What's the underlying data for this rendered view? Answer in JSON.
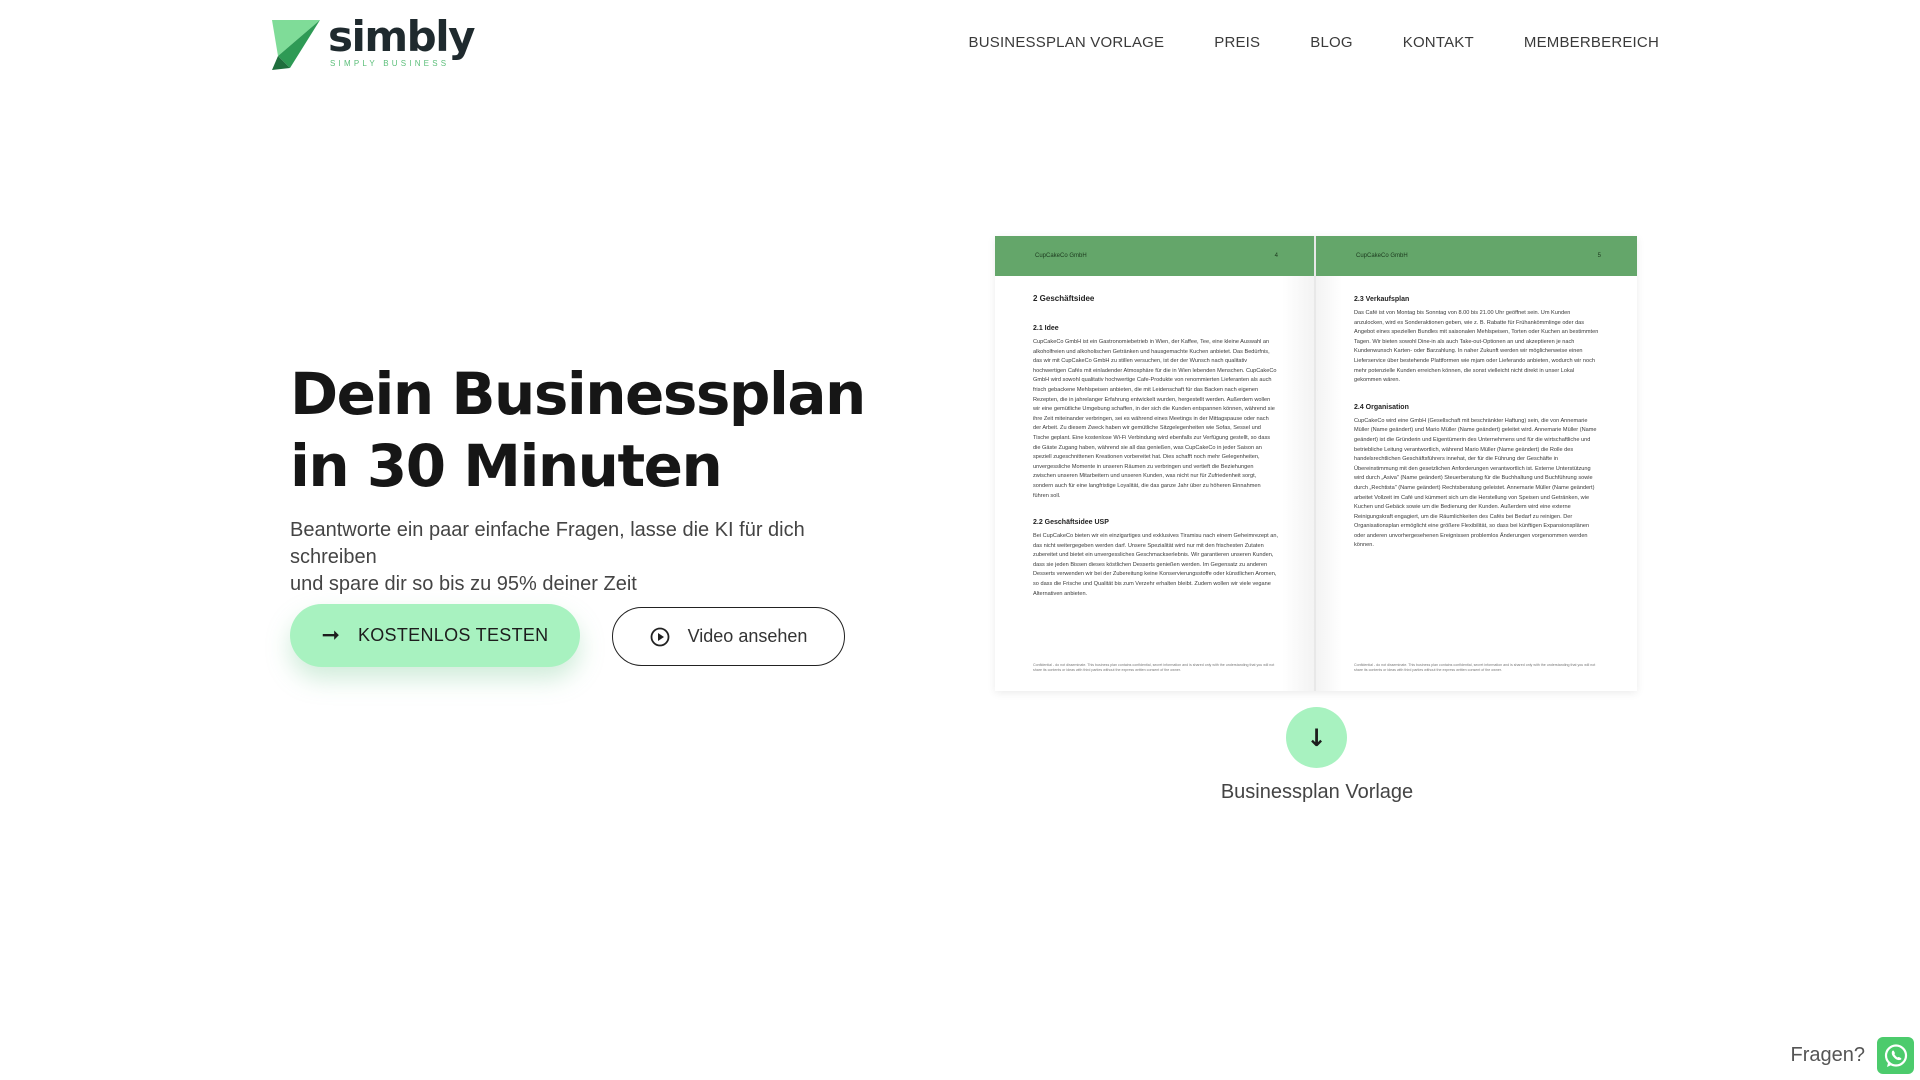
{
  "brand": {
    "name": "simbly",
    "tagline": "SIMPLY BUSINESS",
    "color_dark": "#1f2a2e",
    "color_green": "#5cbf7a"
  },
  "nav": {
    "items": [
      {
        "label": "BUSINESSPLAN VORLAGE"
      },
      {
        "label": "PREIS"
      },
      {
        "label": "BLOG"
      },
      {
        "label": "KONTAKT"
      },
      {
        "label": "MEMBERBEREICH"
      }
    ]
  },
  "hero": {
    "title_line1": "Dein Businessplan",
    "title_line2": "in 30 Minuten",
    "subtitle_line1": "Beantworte ein paar einfache Fragen, lasse die KI für dich schreiben",
    "subtitle_line2": "und spare dir so bis zu 95% deiner Zeit",
    "cta_primary": {
      "label": "KOSTENLOS TESTEN",
      "icon": "arrow-right-icon"
    },
    "cta_video": {
      "label": "Video ansehen",
      "icon": "play-circle-icon"
    },
    "accent_color": "#a8f2c0"
  },
  "document": {
    "header_color": "#64a66a",
    "left_page": {
      "company": "CupCakeCo GmbH",
      "page": "4",
      "h1": "2   Geschäftsidee",
      "sections": [
        {
          "heading": "2.1  Idee",
          "text": "CupCakeCo GmbH ist ein Gastronomiebetrieb in Wien, der Kaffee, Tee, eine kleine Auswahl an alkoholfreien und alkoholischen Getränken und hausgemachte Kuchen anbietet. Das Bedürfnis, das wir mit CupCakeCo GmbH zu stillen versuchen, ist der der Wunsch nach qualitativ hochwertigen Cafés mit einladender Atmosphäre für die in Wien lebenden Menschen. CupCakeCo GmbH wird sowohl qualitativ hochwertige Cafe-Produkte von renommierten Lieferanten als auch frisch gebackene Mehlspeisen anbieten, die mit Leidenschaft für das Backen nach eigenen Rezepten, die in jahrelanger Erfahrung entwickelt wurden, hergestellt werden. Außerdem wollen wir eine gemütliche Umgebung schaffen, in der sich die Kunden entspannen können, während sie ihre Zeit miteinander verbringen, sei es während eines Meetings in der Mittagspause oder nach der Arbeit. Zu diesem Zweck haben wir gemütliche Sitzgelegenheiten wie Sofas, Sessel und Tische geplant. Eine kostenlose Wi-Fi Verbindung wird ebenfalls zur Verfügung gestellt, so dass die Gäste Zugang haben, während sie all das genießen, was CupCakeCo in jeder Saison an speziell zugeschnittenen Kreationen vorbereitet hat. Dies schafft noch mehr Gelegenheiten, unvergessliche Momente in unseren Räumen zu verbringen und vertieft die Beziehungen zwischen unseren Mitarbeitern und unseren Kunden, was nicht nur für Zufriedenheit sorgt, sondern auch für eine langfristige Loyalität, die das ganze Jahr über zu höheren Einnahmen führen soll."
        },
        {
          "heading": "2.2  Geschäftsidee USP",
          "text": "Bei CupCakeCo bieten wir ein einzigartiges und exklusives Tiramisu nach einem Geheimrezept an, das nicht weitergegeben werden darf. Unsere Spezialität wird nur mit den frischesten Zutaten zubereitet und bietet ein unvergessliches Geschmackserlebnis. Wir garantieren unseren Kunden, dass sie jeden Bissen dieses köstlichen Desserts genießen werden. Im Gegensatz zu anderen Desserts verwenden wir bei der Zubereitung keine Konservierungsstoffe oder künstlichen Aromen, so dass die Frische und Qualität bis zum Verzehr erhalten bleibt. Zudem wollen wir viele vegane Alternativen anbieten."
        }
      ],
      "footer": "Confidential - do not disseminate. This business plan contains confidential, secret information and is shared only with the understanding that you will not share its contents or ideas with third parties without the express written consent of the owner."
    },
    "right_page": {
      "company": "CupCakeCo GmbH",
      "page": "5",
      "sections": [
        {
          "heading": "2.3  Verkaufsplan",
          "text": "Das Café ist von Montag bis Sonntag von 8.00 bis 21.00 Uhr geöffnet sein. Um Kunden anzulocken, wird es Sonderaktionen geben, wie z. B. Rabatte für Frühankömmlinge oder das Angebot eines speziellen Bundles mit saisonalen Mehlspeisen, Torten oder Kuchen an bestimmten Tagen. Wir bieten sowohl Dine-in als auch Take-out-Optionen an und akzeptieren je nach Kundenwunsch Karten- oder Barzahlung. In naher Zukunft werden wir möglicherweise einen Lieferservice über bestehende Plattformen wie mjam oder Lieferando anbieten, wodurch wir noch mehr potenzielle Kunden erreichen können, die sonst vielleicht nicht direkt in unser Lokal gekommen wären."
        },
        {
          "heading": "2.4  Organisation",
          "text": "CupCakeCo wird eine GmbH (Gesellschaft mit beschränkter Haftung) sein, die von Annemarie Müller (Name geändert) und Mario Müller (Name geändert) geleitet wird. Annemarie Müller (Name geändert) ist die Gründerin und Eigentümerin des Unternehmens und für die wirtschaftliche und betriebliche Leitung verantwortlich, während Mario Müller (Name geändert) die Rolle des handelsrechtlichen Geschäftsführers innehat, der für die Führung der Geschäfte in Übereinstimmung mit den gesetzlichen Anforderungen verantwortlich ist. Externe Unterstützung wird durch „Asiva\" (Name geändert) Steuerberatung für die Buchhaltung und Buchführung sowie durch „Rechtista\" (Name geändert) Rechtsberatung geleistet. Annemarie Müller (Name geändert) arbeitet Vollzeit im Café und kümmert sich um die Herstellung von Speisen und Getränken, wie Kuchen und Gebäck sowie um die Bedienung der Kunden. Außerdem wird eine externe Reinigungskraft engagiert, um die Räumlichkeiten des Cafés bei Bedarf zu reinigen. Der Organisationsplan ermöglicht eine größere Flexibilität, so dass bei künftigen Expansionsplänen oder anderen unvorhergesehenen Ereignissen problemlos Änderungen vorgenommen werden können."
        }
      ],
      "footer": "Confidential - do not disseminate. This business plan contains confidential, secret information and is shared only with the understanding that you will not share its contents or ideas with third parties without the express written consent of the owner."
    }
  },
  "download": {
    "icon": "arrow-down-icon",
    "label": "Businessplan Vorlage"
  },
  "chat": {
    "label": "Fragen?",
    "icon": "whatsapp-icon",
    "color": "#4ccb6c"
  }
}
